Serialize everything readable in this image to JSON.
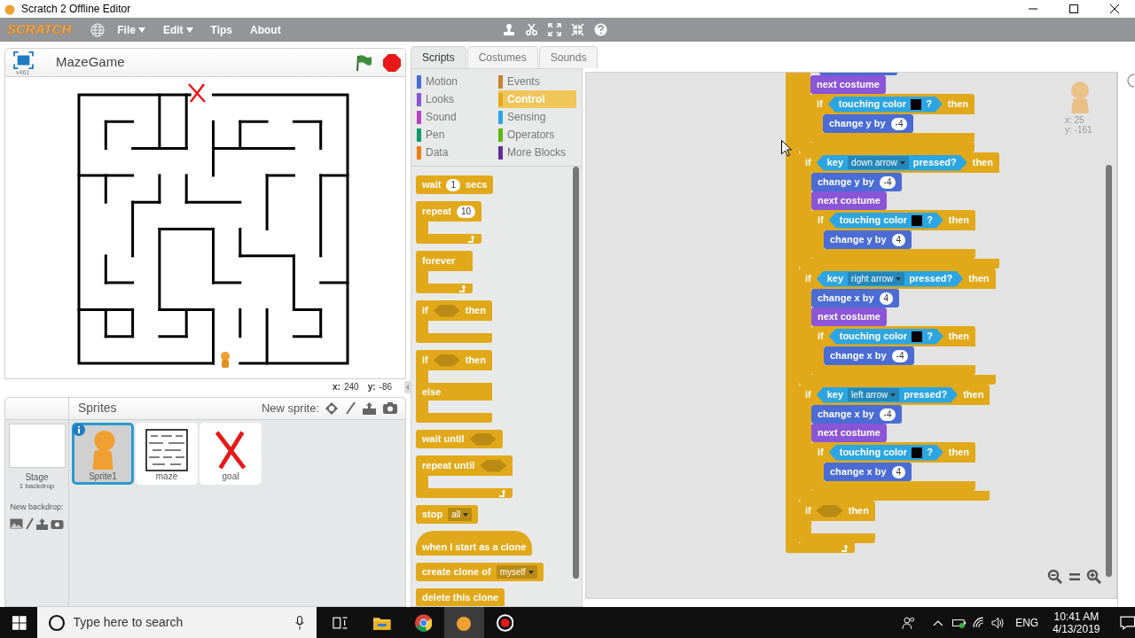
{
  "window": {
    "title": "Scratch 2 Offline Editor"
  },
  "menu": {
    "logo": "SCRATCH",
    "items": [
      {
        "label": "File",
        "dropdown": true
      },
      {
        "label": "Edit",
        "dropdown": true
      },
      {
        "label": "Tips",
        "dropdown": false
      },
      {
        "label": "About",
        "dropdown": false
      }
    ]
  },
  "stage": {
    "title": "MazeGame",
    "version": "v461",
    "x_label": "x:",
    "x_value": "240",
    "y_label": "y:",
    "y_value": "-86"
  },
  "sprites_pane": {
    "title": "Sprites",
    "new_sprite_label": "New sprite:",
    "stage_tile": {
      "name": "Stage",
      "detail": "1 backdrop"
    },
    "new_backdrop_label": "New backdrop:",
    "sprites": [
      {
        "name": "Sprite1",
        "kind": "figure",
        "selected": true
      },
      {
        "name": "maze",
        "kind": "maze",
        "selected": false
      },
      {
        "name": "goal",
        "kind": "cross",
        "selected": false
      }
    ]
  },
  "tabs": [
    {
      "label": "Scripts",
      "selected": true
    },
    {
      "label": "Costumes",
      "selected": false
    },
    {
      "label": "Sounds",
      "selected": false
    }
  ],
  "categories": [
    {
      "label": "Motion",
      "color": "#4a6cd4",
      "selected": false
    },
    {
      "label": "Events",
      "color": "#c88330",
      "selected": false
    },
    {
      "label": "Looks",
      "color": "#8a55d7",
      "selected": false
    },
    {
      "label": "Control",
      "color": "#e1a91a",
      "selected": true
    },
    {
      "label": "Sound",
      "color": "#bb42c3",
      "selected": false
    },
    {
      "label": "Sensing",
      "color": "#2ca5e2",
      "selected": false
    },
    {
      "label": "Pen",
      "color": "#0e9a6c",
      "selected": false
    },
    {
      "label": "Operators",
      "color": "#5cb712",
      "selected": false
    },
    {
      "label": "Data",
      "color": "#ee7d16",
      "selected": false
    },
    {
      "label": "More Blocks",
      "color": "#632d99",
      "selected": false
    }
  ],
  "palette_blocks": [
    {
      "kind": "command",
      "color": "#e1a91a",
      "parts": [
        {
          "kind": "text",
          "text": "wait"
        },
        {
          "kind": "number",
          "text": "1"
        },
        {
          "kind": "text",
          "text": "secs"
        }
      ]
    },
    {
      "kind": "loop",
      "parts": [
        {
          "kind": "text",
          "text": "repeat"
        },
        {
          "kind": "number",
          "text": "10"
        }
      ]
    },
    {
      "kind": "loop",
      "parts": [
        {
          "kind": "text",
          "text": "forever"
        }
      ]
    },
    {
      "kind": "if",
      "parts": [
        {
          "kind": "text",
          "text": "if"
        },
        {
          "kind": "slot"
        },
        {
          "kind": "text",
          "text": "then"
        }
      ]
    },
    {
      "kind": "if_else",
      "parts": [
        {
          "kind": "text",
          "text": "if"
        },
        {
          "kind": "slot"
        },
        {
          "kind": "text",
          "text": "then"
        }
      ],
      "else_parts": [
        {
          "kind": "text",
          "text": "else"
        }
      ]
    },
    {
      "kind": "command",
      "color": "#e1a91a",
      "parts": [
        {
          "kind": "text",
          "text": "wait until"
        },
        {
          "kind": "slot"
        }
      ]
    },
    {
      "kind": "loop",
      "parts": [
        {
          "kind": "text",
          "text": "repeat until"
        },
        {
          "kind": "slot"
        }
      ]
    },
    {
      "kind": "command",
      "color": "#e1a91a",
      "parts": [
        {
          "kind": "text",
          "text": "stop"
        },
        {
          "kind": "dropdown",
          "text": "all"
        }
      ]
    },
    {
      "kind": "hat",
      "color": "#e1a91a",
      "parts": [
        {
          "kind": "text",
          "text": "when I start as a clone"
        }
      ]
    },
    {
      "kind": "command",
      "color": "#e1a91a",
      "parts": [
        {
          "kind": "text",
          "text": "create clone of"
        },
        {
          "kind": "dropdown",
          "text": "myself"
        }
      ]
    },
    {
      "kind": "command",
      "color": "#e1a91a",
      "parts": [
        {
          "kind": "text",
          "text": "delete this clone"
        }
      ]
    }
  ],
  "script": {
    "kind": "loop_tail",
    "children": [
      {
        "kind": "if_tail",
        "children": [
          {
            "kind": "edge",
            "color": "#4a6cd4"
          },
          {
            "kind": "command",
            "color": "#8a55d7",
            "parts": [
              {
                "kind": "text",
                "text": "next costume"
              }
            ]
          },
          {
            "kind": "if",
            "parts": [
              {
                "kind": "text",
                "text": "if"
              },
              {
                "kind": "boolean",
                "parts": [
                  {
                    "kind": "text",
                    "text": "touching color"
                  },
                  {
                    "kind": "swatch",
                    "color": "#000000"
                  },
                  {
                    "kind": "text",
                    "text": "?"
                  }
                ]
              },
              {
                "kind": "text",
                "text": "then"
              }
            ],
            "children": [
              {
                "kind": "command",
                "color": "#4a6cd4",
                "parts": [
                  {
                    "kind": "text",
                    "text": "change y by"
                  },
                  {
                    "kind": "number",
                    "text": "-4"
                  }
                ]
              }
            ]
          }
        ]
      },
      {
        "kind": "if",
        "parts": [
          {
            "kind": "text",
            "text": "if"
          },
          {
            "kind": "boolean",
            "parts": [
              {
                "kind": "text",
                "text": "key"
              },
              {
                "kind": "dropdown",
                "text": "down arrow"
              },
              {
                "kind": "text",
                "text": "pressed?"
              }
            ]
          },
          {
            "kind": "text",
            "text": "then"
          }
        ],
        "children": [
          {
            "kind": "command",
            "color": "#4a6cd4",
            "parts": [
              {
                "kind": "text",
                "text": "change y by"
              },
              {
                "kind": "number",
                "text": "-4"
              }
            ]
          },
          {
            "kind": "command",
            "color": "#8a55d7",
            "parts": [
              {
                "kind": "text",
                "text": "next costume"
              }
            ]
          },
          {
            "kind": "if",
            "parts": [
              {
                "kind": "text",
                "text": "if"
              },
              {
                "kind": "boolean",
                "parts": [
                  {
                    "kind": "text",
                    "text": "touching color"
                  },
                  {
                    "kind": "swatch",
                    "color": "#000000"
                  },
                  {
                    "kind": "text",
                    "text": "?"
                  }
                ]
              },
              {
                "kind": "text",
                "text": "then"
              }
            ],
            "children": [
              {
                "kind": "command",
                "color": "#4a6cd4",
                "parts": [
                  {
                    "kind": "text",
                    "text": "change y by"
                  },
                  {
                    "kind": "number",
                    "text": "4"
                  }
                ]
              }
            ]
          }
        ]
      },
      {
        "kind": "if",
        "parts": [
          {
            "kind": "text",
            "text": "if"
          },
          {
            "kind": "boolean",
            "parts": [
              {
                "kind": "text",
                "text": "key"
              },
              {
                "kind": "dropdown",
                "text": "right arrow"
              },
              {
                "kind": "text",
                "text": "pressed?"
              }
            ]
          },
          {
            "kind": "text",
            "text": "then"
          }
        ],
        "children": [
          {
            "kind": "command",
            "color": "#4a6cd4",
            "parts": [
              {
                "kind": "text",
                "text": "change x by"
              },
              {
                "kind": "number",
                "text": "4"
              }
            ]
          },
          {
            "kind": "command",
            "color": "#8a55d7",
            "parts": [
              {
                "kind": "text",
                "text": "next costume"
              }
            ]
          },
          {
            "kind": "if",
            "parts": [
              {
                "kind": "text",
                "text": "if"
              },
              {
                "kind": "boolean",
                "parts": [
                  {
                    "kind": "text",
                    "text": "touching color"
                  },
                  {
                    "kind": "swatch",
                    "color": "#000000"
                  },
                  {
                    "kind": "text",
                    "text": "?"
                  }
                ]
              },
              {
                "kind": "text",
                "text": "then"
              }
            ],
            "children": [
              {
                "kind": "command",
                "color": "#4a6cd4",
                "parts": [
                  {
                    "kind": "text",
                    "text": "change x by"
                  },
                  {
                    "kind": "number",
                    "text": "-4"
                  }
                ]
              }
            ]
          }
        ]
      },
      {
        "kind": "if",
        "parts": [
          {
            "kind": "text",
            "text": "if"
          },
          {
            "kind": "boolean",
            "parts": [
              {
                "kind": "text",
                "text": "key"
              },
              {
                "kind": "dropdown",
                "text": "left arrow"
              },
              {
                "kind": "text",
                "text": "pressed?"
              }
            ]
          },
          {
            "kind": "text",
            "text": "then"
          }
        ],
        "children": [
          {
            "kind": "command",
            "color": "#4a6cd4",
            "parts": [
              {
                "kind": "text",
                "text": "change x by"
              },
              {
                "kind": "number",
                "text": "-4"
              }
            ]
          },
          {
            "kind": "command",
            "color": "#8a55d7",
            "parts": [
              {
                "kind": "text",
                "text": "next costume"
              }
            ]
          },
          {
            "kind": "if",
            "parts": [
              {
                "kind": "text",
                "text": "if"
              },
              {
                "kind": "boolean",
                "parts": [
                  {
                    "kind": "text",
                    "text": "touching color"
                  },
                  {
                    "kind": "swatch",
                    "color": "#000000"
                  },
                  {
                    "kind": "text",
                    "text": "?"
                  }
                ]
              },
              {
                "kind": "text",
                "text": "then"
              }
            ],
            "children": [
              {
                "kind": "command",
                "color": "#4a6cd4",
                "parts": [
                  {
                    "kind": "text",
                    "text": "change x by"
                  },
                  {
                    "kind": "number",
                    "text": "4"
                  }
                ]
              }
            ]
          }
        ]
      },
      {
        "kind": "if",
        "parts": [
          {
            "kind": "text",
            "text": "if"
          },
          {
            "kind": "slot"
          },
          {
            "kind": "text",
            "text": "then"
          }
        ]
      }
    ]
  },
  "sprite_info": {
    "x": "x: 25",
    "y": "y: -161"
  },
  "taskbar": {
    "search_placeholder": "Type here to search",
    "language": "ENG",
    "time": "10:41 AM",
    "date": "4/13/2019"
  }
}
